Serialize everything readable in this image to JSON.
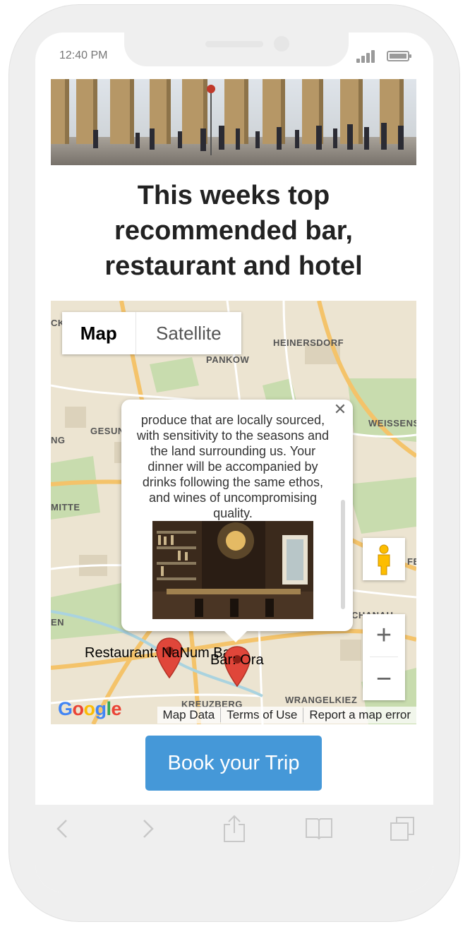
{
  "status_bar": {
    "time": "12:40 PM",
    "signal_icon": "cellular-signal-icon",
    "battery_icon": "battery-icon"
  },
  "hero_image": {
    "icon": "brandenburg-gate-photo"
  },
  "page": {
    "title": "This weeks top recommended bar, restaurant and hotel"
  },
  "map": {
    "type_buttons": {
      "map_label": "Map",
      "satellite_label": "Satellite",
      "selected": "Map"
    },
    "area_labels": [
      "HEINERSDORF",
      "PANKOW",
      "WEISSENS",
      "GESUN",
      "NG",
      "MITTE",
      "FE",
      "CK",
      "EN",
      "KREUZBERG",
      "WRANGELKIEZ",
      "CHANAU"
    ],
    "markers": [
      {
        "label": "Restaurant: NaNum Bao",
        "color": "#e0463a"
      },
      {
        "label": "Bar: Ora",
        "color": "#e0463a"
      }
    ],
    "info_window": {
      "text": "produce that are locally sourced, with sensitivity to the seasons and the land surrounding us. Your dinner will be accompanied by drinks following the same ethos, and wines of uncompromising quality.",
      "photo_icon": "bar-interior-photo",
      "close_icon": "close-icon"
    },
    "controls": {
      "zoom_in": "+",
      "zoom_out": "−",
      "pegman_icon": "street-view-pegman-icon"
    },
    "footer": {
      "logo": "Google",
      "map_data": "Map Data",
      "terms": "Terms of Use",
      "report": "Report a map error"
    }
  },
  "cta": {
    "label": "Book your Trip",
    "color": "#4598d8"
  },
  "browser_toolbar": {
    "icons": [
      "back-icon",
      "forward-icon",
      "share-icon",
      "bookmarks-icon",
      "tabs-icon"
    ]
  }
}
